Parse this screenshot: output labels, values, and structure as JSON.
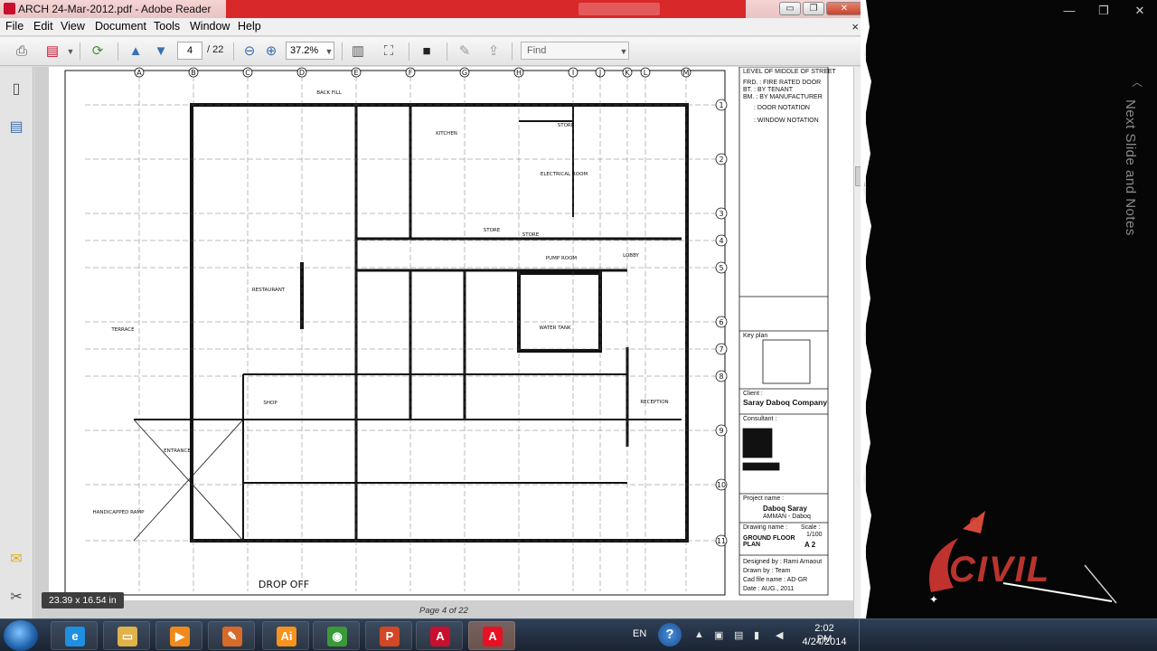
{
  "window": {
    "title": "ARCH 24-Mar-2012.pdf - Adobe Reader",
    "min_label": "▭",
    "max_label": "❐",
    "close_label": "✕"
  },
  "menu": {
    "items": [
      "File",
      "Edit",
      "View",
      "Document",
      "Tools",
      "Window",
      "Help"
    ],
    "close": "×"
  },
  "toolbar": {
    "page_current": "4",
    "page_total": "/ 22",
    "zoom": "37.2%",
    "find_placeholder": "Find"
  },
  "document": {
    "page_of": "Page 4 of 22",
    "dimensions_tip": "23.39 x 16.54 in",
    "rooms": [
      "KITCHEN",
      "STORE",
      "ELECTRICAL ROOM",
      "STORE",
      "STORE",
      "PUMP ROOM",
      "LOBBY",
      "RESTAURANT",
      "TERRACE",
      "WATER TANK",
      "RECEPTION",
      "SHOP",
      "ENTRANCE",
      "HANDICAPPED RAMP",
      "DROP OFF",
      "BACK FILL"
    ],
    "grid_letters": [
      "A",
      "B",
      "C",
      "D",
      "E",
      "F",
      "G",
      "H",
      "I",
      "J",
      "K",
      "L",
      "M"
    ],
    "grid_numbers": [
      "1",
      "2",
      "3",
      "4",
      "5",
      "6",
      "7",
      "8",
      "9",
      "10",
      "11"
    ],
    "legend": [
      "LEVEL OF MIDDLE OF STREET",
      "FRD. : FIRE RATED DOOR",
      "BT. : BY TENANT",
      "BM. : BY MANUFACTURER",
      ": DOOR NOTATION",
      ": WINDOW NOTATION"
    ],
    "title_block": {
      "key_plan": "Key plan",
      "client_label": "Client :",
      "client": "Saray Daboq Company",
      "consultant_label": "Consultant :",
      "project_label": "Project name :",
      "project": "Daboq Saray",
      "project_sub": "AMMAN - Daboq",
      "drawing_label": "Drawing name :",
      "drawing": "GROUND FLOOR PLAN",
      "scale_label": "Scale :",
      "scale": "1/100",
      "sheet": "A 2",
      "designed_by": "Designed by : Rami Arnaout",
      "drawn_by": "Drawn by : Team",
      "cad_file": "Cad file name : AD-GR",
      "date": "Date : AUG., 2011"
    }
  },
  "side_panel": {
    "notes_label": "Next Slide and Notes",
    "logo_text": "CIVIL"
  },
  "taskbar": {
    "language": "EN",
    "help": "?",
    "time": "2:02 PM",
    "date": "4/24/2014",
    "apps": [
      {
        "name": "ie",
        "glyph": "e",
        "color": "#1f8fe0"
      },
      {
        "name": "explorer",
        "glyph": "▭",
        "color": "#e0b24a"
      },
      {
        "name": "media",
        "glyph": "▶",
        "color": "#f08a1c"
      },
      {
        "name": "paint",
        "glyph": "✎",
        "color": "#d66a2a"
      },
      {
        "name": "illustrator",
        "glyph": "Ai",
        "color": "#f7931e"
      },
      {
        "name": "chrome",
        "glyph": "◉",
        "color": "#3a9a3a"
      },
      {
        "name": "powerpoint",
        "glyph": "P",
        "color": "#d24726"
      },
      {
        "name": "acrobat",
        "glyph": "A",
        "color": "#c8102e"
      },
      {
        "name": "reader",
        "glyph": "A",
        "color": "#e81123"
      }
    ]
  }
}
